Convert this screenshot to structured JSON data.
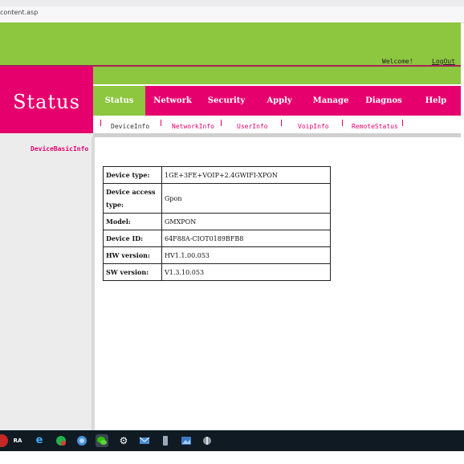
{
  "browser": {
    "url": "content.asp"
  },
  "header": {
    "welcome": "Welcome!",
    "logout": "LogOut",
    "title": "Status"
  },
  "nav": {
    "items": [
      {
        "label": "Status",
        "active": true
      },
      {
        "label": "Network"
      },
      {
        "label": "Security"
      },
      {
        "label": "Apply"
      },
      {
        "label": "Manage"
      },
      {
        "label": "Diagnos"
      },
      {
        "label": "Help"
      }
    ]
  },
  "subnav": {
    "items": [
      {
        "label": "DeviceInfo",
        "active": true
      },
      {
        "label": "NetworkInfo"
      },
      {
        "label": "UserInfo"
      },
      {
        "label": "VoipInfo"
      },
      {
        "label": "RemoteStatus"
      }
    ]
  },
  "sidebar": {
    "link": "DeviceBasicInfo"
  },
  "device_info": {
    "rows": [
      {
        "label": "Device type:",
        "value": "1GE+3FE+VOIP+2.4GWIFI-XPON"
      },
      {
        "label": "Device access type:",
        "value": "Gpon"
      },
      {
        "label": "Model:",
        "value": "GMXPON"
      },
      {
        "label": "Device ID:",
        "value": "64F88A-CIOT0189BFB8"
      },
      {
        "label": "HW version:",
        "value": "HV1.1.00.053"
      },
      {
        "label": "SW version:",
        "value": "V1.3.10.053"
      }
    ]
  },
  "taskbar": {
    "icons": [
      "app-icon",
      "ra-icon",
      "edge-icon",
      "chat-icon",
      "globe-icon",
      "wechat-icon",
      "settings-icon",
      "mail-icon",
      "usb-icon",
      "photo-icon",
      "tool-icon"
    ]
  },
  "colors": {
    "magenta": "#e6006e",
    "green": "#8dc63f"
  }
}
